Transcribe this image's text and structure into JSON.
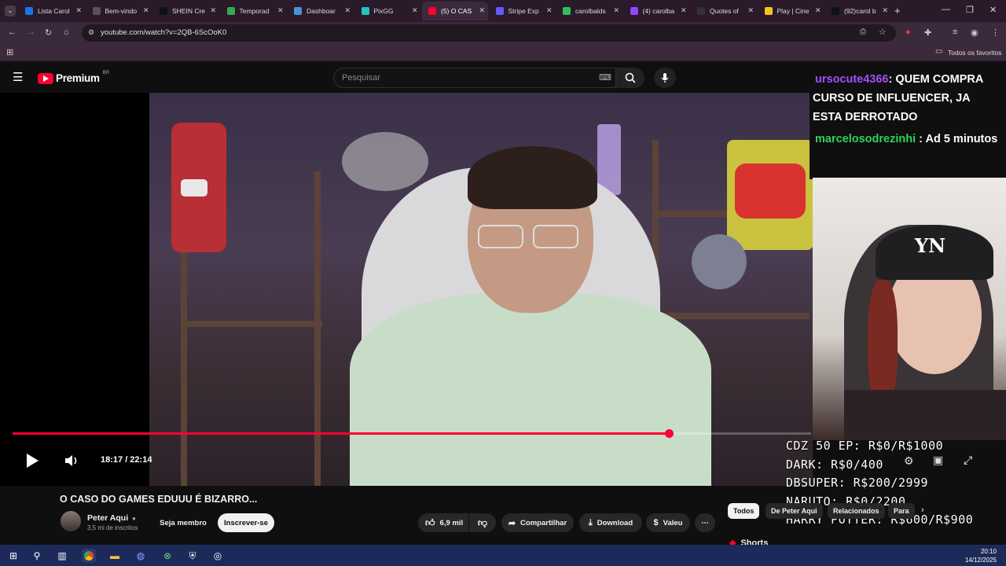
{
  "browser": {
    "tabs": [
      {
        "label": "Lista Carol",
        "color": "#1a73e8"
      },
      {
        "label": "Bem-vindo",
        "color": "#555555"
      },
      {
        "label": "SHEIN Cre",
        "color": "#111111"
      },
      {
        "label": "Temporad",
        "color": "#34a853"
      },
      {
        "label": "Dashboar",
        "color": "#4a90d9"
      },
      {
        "label": "PixGG",
        "color": "#22c1c3"
      },
      {
        "label": "(5) O CAS",
        "color": "#ff0033"
      },
      {
        "label": "Stripe Exp",
        "color": "#635bff"
      },
      {
        "label": "carolbalds",
        "color": "#2fbf5a"
      },
      {
        "label": "(4) carolba",
        "color": "#9146ff"
      },
      {
        "label": "Quotes of",
        "color": "#333333"
      },
      {
        "label": "Play | Cine",
        "color": "#f5c518"
      },
      {
        "label": "(92)carol b",
        "color": "#111111"
      }
    ],
    "url": "youtube.com/watch?v=2QB-6ScOoK0",
    "bookmarks_label": "Todos os favoritos"
  },
  "youtube": {
    "logo_text": "Premium",
    "logo_badge": "BR",
    "search_placeholder": "Pesquisar",
    "video": {
      "time": "18:17 / 22:14",
      "progress": 0.822
    },
    "title": "O CASO DO GAMES EDUUU É BIZARRO...",
    "channel": {
      "name": "Peter Aqui",
      "subscribers": "3,5 mi de inscritos"
    },
    "buttons": {
      "member": "Seja membro",
      "subscribe": "Inscrever-se",
      "likes": "6,9 mil",
      "share": "Compartilhar",
      "download": "Download",
      "thanks": "Valeu"
    },
    "chips": [
      "Todos",
      "De Peter Aqui",
      "Relacionados",
      "Para"
    ],
    "shorts_label": "Shorts"
  },
  "stream_overlay": {
    "chat": [
      {
        "user": "ursocute4366",
        "message": ": QUEM COMPRA CURSO DE INFLUENCER, JA ESTA DERROTADO"
      },
      {
        "user": "marcelosodrezinhi",
        "message": " : Ad 5 minutos"
      }
    ],
    "goals": [
      "CDZ 50 EP: R$0/R$1000",
      "DARK: R$0/400",
      "DBSUPER: R$200/2999",
      "NARUTO: R$0/2200",
      "HARRY POTTER: R$600/R$900"
    ]
  },
  "taskbar": {
    "time": "20:10",
    "date": "14/12/2025"
  }
}
